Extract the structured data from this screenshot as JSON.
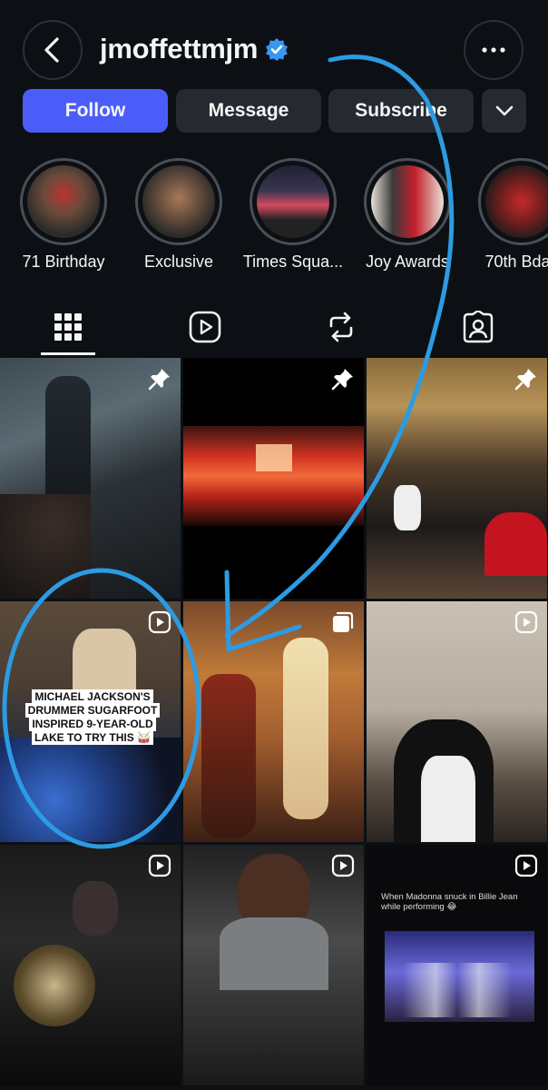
{
  "header": {
    "username": "jmoffettmjm",
    "back_icon": "chevron-left-icon",
    "more_icon": "more-horizontal-icon",
    "verified_icon": "verified-badge-icon",
    "verified_color": "#3897f0"
  },
  "actions": {
    "follow": "Follow",
    "message": "Message",
    "subscribe": "Subscribe",
    "more_icon": "chevron-down-icon",
    "accent": "#4a5df9"
  },
  "highlights": [
    {
      "label": "71 Birthday"
    },
    {
      "label": "Exclusive"
    },
    {
      "label": "Times Squa..."
    },
    {
      "label": "Joy Awards"
    },
    {
      "label": "70th Bday"
    }
  ],
  "tabs": [
    {
      "name": "grid",
      "icon": "grid-icon",
      "active": true
    },
    {
      "name": "reels",
      "icon": "reels-icon"
    },
    {
      "name": "reposts",
      "icon": "repost-icon"
    },
    {
      "name": "tagged",
      "icon": "tagged-user-icon"
    }
  ],
  "posts": [
    {
      "badge": "pin-icon"
    },
    {
      "badge": "pin-icon"
    },
    {
      "badge": "pin-icon"
    },
    {
      "badge": "reel-icon",
      "caption": "MICHAEL JACKSON'S DRUMMER SUGARFOOT INSPIRED 9-YEAR-OLD LAKE TO TRY THIS 🥁"
    },
    {
      "badge": "carousel-icon"
    },
    {
      "badge": "reel-icon"
    },
    {
      "badge": "reel-icon"
    },
    {
      "badge": "reel-icon"
    },
    {
      "badge": "reel-icon",
      "caption": "When Madonna snuck in Billie Jean while performing 😂"
    }
  ],
  "annotation_color": "#2c9be3"
}
